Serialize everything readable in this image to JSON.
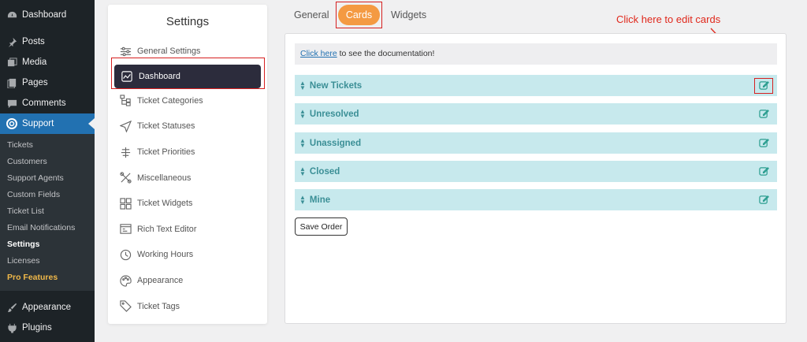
{
  "wp_menu": {
    "dashboard": "Dashboard",
    "posts": "Posts",
    "media": "Media",
    "pages": "Pages",
    "comments": "Comments",
    "support": "Support",
    "submenu": [
      "Tickets",
      "Customers",
      "Support Agents",
      "Custom Fields",
      "Ticket List",
      "Email Notifications",
      "Settings",
      "Licenses",
      "Pro Features"
    ],
    "appearance": "Appearance",
    "plugins": "Plugins"
  },
  "settings": {
    "title": "Settings",
    "items": [
      "General Settings",
      "Dashboard",
      "Ticket Categories",
      "Ticket Statuses",
      "Ticket Priorities",
      "Miscellaneous",
      "Ticket Widgets",
      "Rich Text Editor",
      "Working Hours",
      "Appearance",
      "Ticket Tags"
    ]
  },
  "tabs": {
    "general": "General",
    "cards": "Cards",
    "widgets": "Widgets"
  },
  "annotation": "Click here to edit cards",
  "doc": {
    "link": "Click here",
    "text": " to see the documentation!"
  },
  "cards": [
    "New Tickets",
    "Unresolved",
    "Unassigned",
    "Closed",
    "Mine"
  ],
  "save_label": "Save Order",
  "colors": {
    "accent": "#f49a42",
    "card_bg": "#c7e9ed",
    "card_text": "#3b8f96",
    "wp_active": "#2271b1",
    "highlight": "#d62020"
  }
}
